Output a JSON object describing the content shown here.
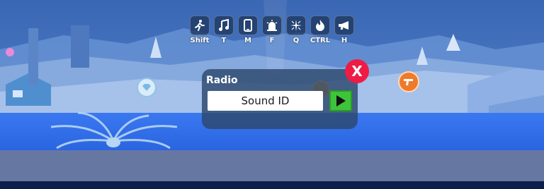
{
  "hotbar": [
    {
      "key": "Shift",
      "icon": "sprint-icon"
    },
    {
      "key": "T",
      "icon": "music-note-icon"
    },
    {
      "key": "M",
      "icon": "phone-icon"
    },
    {
      "key": "F",
      "icon": "siren-icon"
    },
    {
      "key": "Q",
      "icon": "sparkle-icon"
    },
    {
      "key": "CTRL",
      "icon": "fire-icon"
    },
    {
      "key": "H",
      "icon": "horn-icon"
    }
  ],
  "radio": {
    "title": "Radio",
    "input_placeholder": "Sound ID",
    "close_label": "X",
    "play_icon": "play-icon"
  },
  "markers": [
    {
      "icon": "diamond-marker-icon",
      "color": "#ffffff"
    },
    {
      "icon": "gun-store-marker-icon",
      "color": "#f07a2a"
    },
    {
      "icon": "orange-marker-icon",
      "color": "#e79a2a"
    }
  ],
  "colors": {
    "sky": "#3f74c4",
    "panel": "#2d486e",
    "play_green": "#3ec43a",
    "close_red": "#ee1c45",
    "water": "#2f6ff0"
  }
}
